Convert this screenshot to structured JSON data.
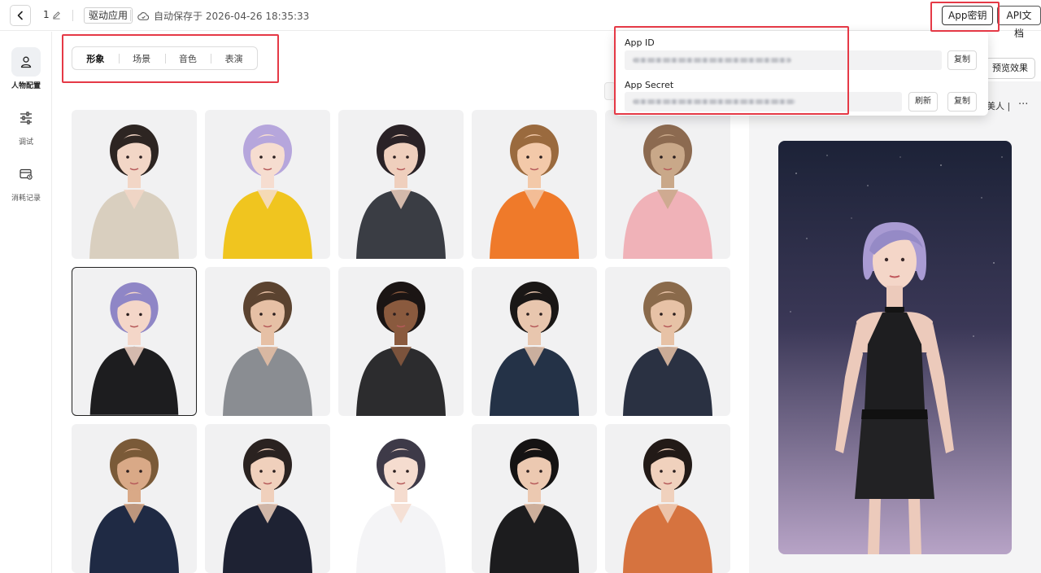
{
  "header": {
    "item_count": "1",
    "app_tag": "驱动应用",
    "autosave_text": "自动保存于 2026-04-26 18:35:33",
    "app_key_label": "App密钥",
    "api_docs_label": "API文档"
  },
  "sidebar": {
    "items": [
      {
        "label": "人物配置",
        "icon": "person-icon"
      },
      {
        "label": "调试",
        "icon": "sliders-icon"
      },
      {
        "label": "消耗记录",
        "icon": "card-record-icon"
      }
    ]
  },
  "tabs": [
    "形象",
    "场景",
    "音色",
    "表演"
  ],
  "popup": {
    "app_id_label": "App ID",
    "app_secret_label": "App Secret",
    "copy_label": "复制",
    "refresh_label": "刷新"
  },
  "preview": {
    "button_label": "预览效果",
    "voice_tag": "美人 |",
    "more": "..."
  },
  "colors": {
    "accent_border": "#222222",
    "highlight_red": "#e53946",
    "stage_top": "#1c2237",
    "stage_bottom": "#b7a3c6"
  },
  "avatars": [
    {
      "hair": "#2d2522",
      "skin": "#f2d6c6",
      "shirt": "#d9cfbf",
      "bg": "#f1f1f2"
    },
    {
      "hair": "#b6a6dc",
      "skin": "#f6ddd0",
      "shirt": "#f0c51f",
      "bg": "#f1f1f2"
    },
    {
      "hair": "#2a2226",
      "skin": "#efcfbd",
      "shirt": "#3a3d44",
      "bg": "#f1f1f2"
    },
    {
      "hair": "#9a6a3e",
      "skin": "#f3c9a9",
      "shirt": "#ef7a2a",
      "bg": "#f1f1f2"
    },
    {
      "hair": "#8c6a50",
      "skin": "#c9a889",
      "shirt": "#f0b2b8",
      "bg": "#f1f1f2"
    },
    {
      "hair": "#8f86c6",
      "skin": "#f4d6c8",
      "shirt": "#1d1d1f",
      "bg": "#f1f1f2"
    },
    {
      "hair": "#5b4330",
      "skin": "#e6c0a5",
      "shirt": "#8a8d92",
      "bg": "#f1f1f2"
    },
    {
      "hair": "#1b1514",
      "skin": "#8a5a3e",
      "shirt": "#2c2c2e",
      "bg": "#f1f1f2"
    },
    {
      "hair": "#1a1716",
      "skin": "#e8c6ae",
      "shirt": "#243247",
      "bg": "#f1f1f2"
    },
    {
      "hair": "#8a6a4b",
      "skin": "#e7c2a6",
      "shirt": "#2a3142",
      "bg": "#f1f1f2"
    },
    {
      "hair": "#7a5a38",
      "skin": "#d9a987",
      "shirt": "#1f2a44",
      "bg": "#f1f1f2"
    },
    {
      "hair": "#2a2220",
      "skin": "#f0d0bc",
      "shirt": "#1e2233",
      "bg": "#f1f1f2"
    },
    {
      "hair": "#3e3a48",
      "skin": "#f5dccf",
      "shirt": "#f4f4f6",
      "bg": "#ffffff"
    },
    {
      "hair": "#151313",
      "skin": "#ecc9b1",
      "shirt": "#1c1c1e",
      "bg": "#f1f1f2"
    },
    {
      "hair": "#221a17",
      "skin": "#f0d1bd",
      "shirt": "#d6733f",
      "bg": "#f1f1f2"
    }
  ]
}
